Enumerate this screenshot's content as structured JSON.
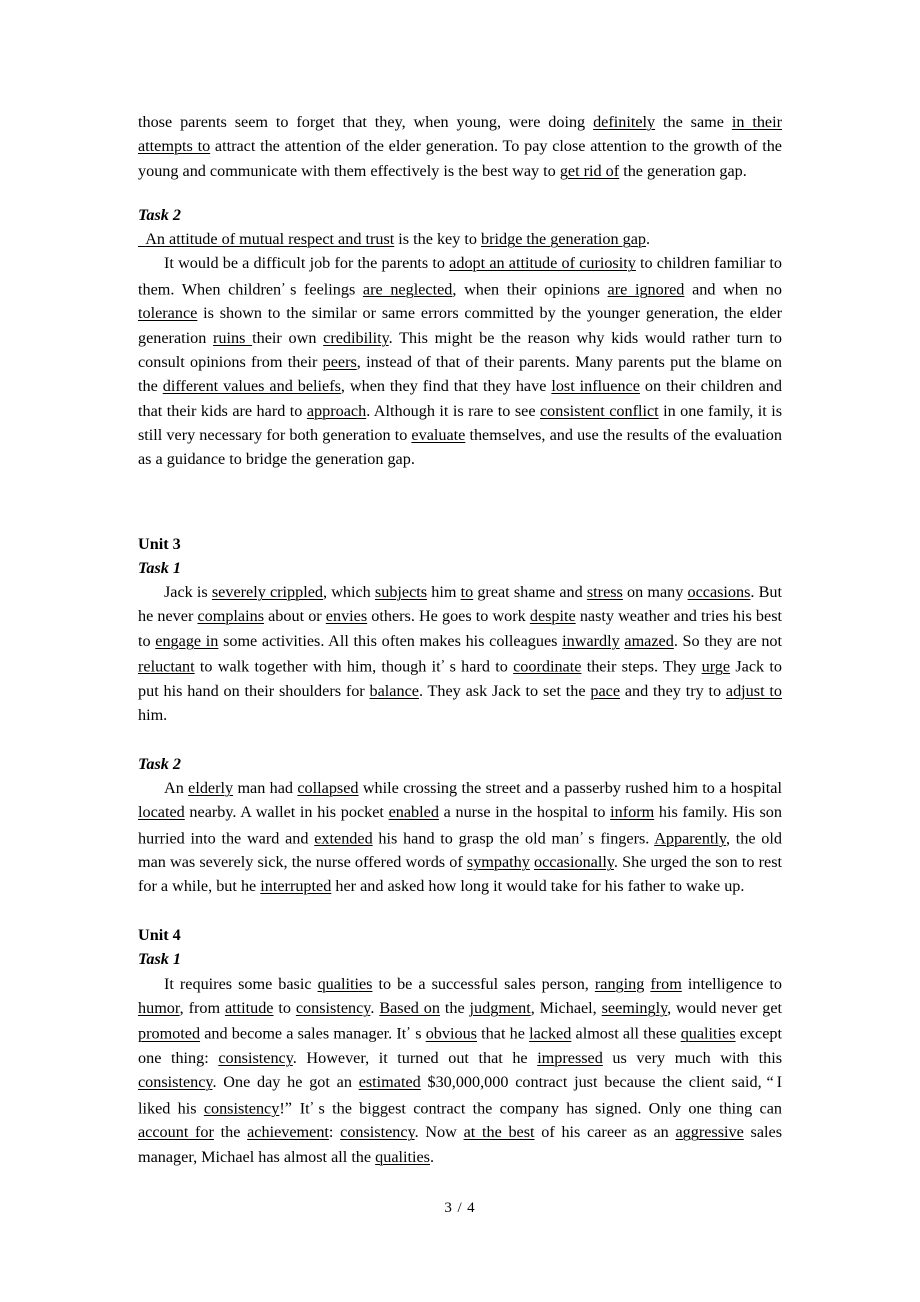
{
  "document": {
    "page_footer": "3 / 4",
    "kind": "exercise-answer-key"
  },
  "blocks": {
    "continued_paragraph": {
      "segments": [
        {
          "t": "those parents seem to forget that they, when young, were doing ",
          "u": false
        },
        {
          "t": "definitely",
          "u": true
        },
        {
          "t": " the same ",
          "u": false
        },
        {
          "t": "in their attempts to",
          "u": true
        },
        {
          "t": " attract the attention of the elder generation. To pay close attention to the growth of the young and communicate with them effectively is the best way to ",
          "u": false
        },
        {
          "t": "get rid of",
          "u": true
        },
        {
          "t": " the generation gap.",
          "u": false
        }
      ]
    },
    "unit2_task2": {
      "task_label": "Task 2",
      "answer_line": {
        "lead_underscore": "  ",
        "segments": [
          {
            "t": "An attitude of mutual respect and trust",
            "u": true
          },
          {
            "t": " is the key to ",
            "u": false
          },
          {
            "t": "bridge the generation gap",
            "u": true
          },
          {
            "t": ".",
            "u": false
          }
        ]
      },
      "body": {
        "segments": [
          {
            "t": "It would be a difficult job for the parents to ",
            "u": false
          },
          {
            "t": "adopt an attitude of curiosity",
            "u": true
          },
          {
            "t": " to children familiar to them. When children",
            "u": false
          },
          {
            "t": "’",
            "u": false,
            "apos": true
          },
          {
            "t": "s feelings ",
            "u": false
          },
          {
            "t": "are neglected",
            "u": true
          },
          {
            "t": ", when their opinions ",
            "u": false
          },
          {
            "t": "are ignored",
            "u": true
          },
          {
            "t": " and when no ",
            "u": false
          },
          {
            "t": "tolerance",
            "u": true
          },
          {
            "t": " is shown to the similar or same errors committed by the younger generation, the elder generation ",
            "u": false
          },
          {
            "t": "ruins ",
            "u": true
          },
          {
            "t": "their own ",
            "u": false
          },
          {
            "t": "credibility",
            "u": true
          },
          {
            "t": ". This might be the reason why kids would rather turn to consult opinions from their ",
            "u": false
          },
          {
            "t": "peers",
            "u": true
          },
          {
            "t": ", instead of that of their parents. Many parents put the blame on the ",
            "u": false
          },
          {
            "t": "different values and beliefs",
            "u": true
          },
          {
            "t": ", when they find that they have ",
            "u": false
          },
          {
            "t": "lost influence",
            "u": true
          },
          {
            "t": " on their children and that their kids are hard to ",
            "u": false
          },
          {
            "t": "approach",
            "u": true
          },
          {
            "t": ". Although it is rare to see ",
            "u": false
          },
          {
            "t": "consistent conflict",
            "u": true
          },
          {
            "t": " in one family, it is still very necessary for both generation to ",
            "u": false
          },
          {
            "t": "evaluate",
            "u": true
          },
          {
            "t": " themselves, and use the results of the evaluation as a guidance to bridge the generation gap.",
            "u": false
          }
        ]
      }
    },
    "unit3": {
      "unit_label": "Unit 3",
      "task1": {
        "task_label": "Task 1",
        "body": {
          "segments": [
            {
              "t": "Jack is ",
              "u": false
            },
            {
              "t": "severely crippled",
              "u": true
            },
            {
              "t": ", which ",
              "u": false
            },
            {
              "t": "subjects",
              "u": true
            },
            {
              "t": " him ",
              "u": false
            },
            {
              "t": "to",
              "u": true
            },
            {
              "t": " great shame and ",
              "u": false
            },
            {
              "t": "stress",
              "u": true
            },
            {
              "t": " on many ",
              "u": false
            },
            {
              "t": "occasions",
              "u": true
            },
            {
              "t": ". But he never ",
              "u": false
            },
            {
              "t": "complains",
              "u": true
            },
            {
              "t": " about or ",
              "u": false
            },
            {
              "t": "envies",
              "u": true
            },
            {
              "t": " others. He goes to work ",
              "u": false
            },
            {
              "t": "despite",
              "u": true
            },
            {
              "t": " nasty weather and tries his best to ",
              "u": false
            },
            {
              "t": "engage in",
              "u": true
            },
            {
              "t": " some activities. All this often makes his colleagues ",
              "u": false
            },
            {
              "t": "inwardly",
              "u": true
            },
            {
              "t": " ",
              "u": false
            },
            {
              "t": "amazed",
              "u": true
            },
            {
              "t": ". So they are not ",
              "u": false
            },
            {
              "t": "reluctant",
              "u": true
            },
            {
              "t": " to walk together with him, though it",
              "u": false
            },
            {
              "t": "’",
              "u": false,
              "apos": true
            },
            {
              "t": "s hard to ",
              "u": false
            },
            {
              "t": "coordinate",
              "u": true
            },
            {
              "t": " their steps. They ",
              "u": false
            },
            {
              "t": "urge",
              "u": true
            },
            {
              "t": " Jack to put his hand on their shoulders for ",
              "u": false
            },
            {
              "t": "balance",
              "u": true
            },
            {
              "t": ". They ask Jack to set the ",
              "u": false
            },
            {
              "t": "pace",
              "u": true
            },
            {
              "t": " and they try to ",
              "u": false
            },
            {
              "t": "adjust to",
              "u": true
            },
            {
              "t": " him.",
              "u": false
            }
          ]
        }
      },
      "task2": {
        "task_label": "Task 2",
        "body": {
          "segments": [
            {
              "t": "An ",
              "u": false
            },
            {
              "t": "elderly",
              "u": true
            },
            {
              "t": " man had ",
              "u": false
            },
            {
              "t": "collapsed",
              "u": true
            },
            {
              "t": " while crossing the street and a passerby rushed him to a hospital ",
              "u": false
            },
            {
              "t": "located",
              "u": true
            },
            {
              "t": " nearby. A wallet in his pocket ",
              "u": false
            },
            {
              "t": "enabled",
              "u": true
            },
            {
              "t": " a nurse in the hospital to ",
              "u": false
            },
            {
              "t": "inform",
              "u": true
            },
            {
              "t": " his family. His son hurried into the ward and ",
              "u": false
            },
            {
              "t": "extended",
              "u": true
            },
            {
              "t": " his hand to grasp the old man",
              "u": false
            },
            {
              "t": "’",
              "u": false,
              "apos": true
            },
            {
              "t": "s fingers. ",
              "u": false
            },
            {
              "t": "Apparently",
              "u": true
            },
            {
              "t": ", the old man was severely sick, the nurse offered words of ",
              "u": false
            },
            {
              "t": "sympathy",
              "u": true
            },
            {
              "t": " ",
              "u": false
            },
            {
              "t": "occasionally",
              "u": true
            },
            {
              "t": ". She urged the son to rest for a while, but he ",
              "u": false
            },
            {
              "t": "interrupted",
              "u": true
            },
            {
              "t": " her and asked how long it would take for his father to wake up.",
              "u": false
            }
          ]
        }
      }
    },
    "unit4": {
      "unit_label": "Unit 4",
      "task1": {
        "task_label": "Task 1",
        "body": {
          "segments": [
            {
              "t": "It requires some basic ",
              "u": false
            },
            {
              "t": "qualities",
              "u": true
            },
            {
              "t": " to be a successful sales person, ",
              "u": false
            },
            {
              "t": "ranging",
              "u": true
            },
            {
              "t": " ",
              "u": false
            },
            {
              "t": "from",
              "u": true
            },
            {
              "t": " intelligence to ",
              "u": false
            },
            {
              "t": "humor",
              "u": true
            },
            {
              "t": ", from ",
              "u": false
            },
            {
              "t": "attitude",
              "u": true
            },
            {
              "t": " to ",
              "u": false
            },
            {
              "t": "consistency",
              "u": true
            },
            {
              "t": ". ",
              "u": false
            },
            {
              "t": "Based on",
              "u": true
            },
            {
              "t": " the ",
              "u": false
            },
            {
              "t": "judgment",
              "u": true
            },
            {
              "t": ", Michael, ",
              "u": false
            },
            {
              "t": "seemingly",
              "u": true
            },
            {
              "t": ", would never get ",
              "u": false
            },
            {
              "t": "promoted",
              "u": true
            },
            {
              "t": " and become a sales manager. It",
              "u": false
            },
            {
              "t": "’",
              "u": false,
              "apos": true
            },
            {
              "t": "s ",
              "u": false
            },
            {
              "t": "obvious",
              "u": true
            },
            {
              "t": " that he ",
              "u": false
            },
            {
              "t": "lacked",
              "u": true
            },
            {
              "t": " almost all these ",
              "u": false
            },
            {
              "t": "qualities",
              "u": true
            },
            {
              "t": " except one thing: ",
              "u": false
            },
            {
              "t": "consistency",
              "u": true
            },
            {
              "t": ". However, it turned out that he ",
              "u": false
            },
            {
              "t": "impressed",
              "u": true
            },
            {
              "t": " us very much with this ",
              "u": false
            },
            {
              "t": "consistency",
              "u": true
            },
            {
              "t": ". One day he got an ",
              "u": false
            },
            {
              "t": "estimated",
              "u": true
            },
            {
              "t": " $30,000,000 contract just because the client said,",
              "u": false
            },
            {
              "t": "“",
              "u": false,
              "dq": "open"
            },
            {
              "t": "I liked his ",
              "u": false
            },
            {
              "t": "consistency",
              "u": true
            },
            {
              "t": "!",
              "u": false
            },
            {
              "t": "”",
              "u": false,
              "dq": "close"
            },
            {
              "t": "It",
              "u": false
            },
            {
              "t": "’",
              "u": false,
              "apos": true
            },
            {
              "t": "s the biggest contract the company has signed. Only one thing can ",
              "u": false
            },
            {
              "t": "account for",
              "u": true
            },
            {
              "t": " the ",
              "u": false
            },
            {
              "t": "achievement",
              "u": true
            },
            {
              "t": ": ",
              "u": false
            },
            {
              "t": "consistency",
              "u": true
            },
            {
              "t": ". Now ",
              "u": false
            },
            {
              "t": "at the best",
              "u": true
            },
            {
              "t": " of his career as an ",
              "u": false
            },
            {
              "t": "aggressive",
              "u": true
            },
            {
              "t": " sales manager, Michael has almost all the ",
              "u": false
            },
            {
              "t": "qualities",
              "u": true
            },
            {
              "t": ".",
              "u": false
            }
          ]
        }
      }
    }
  }
}
